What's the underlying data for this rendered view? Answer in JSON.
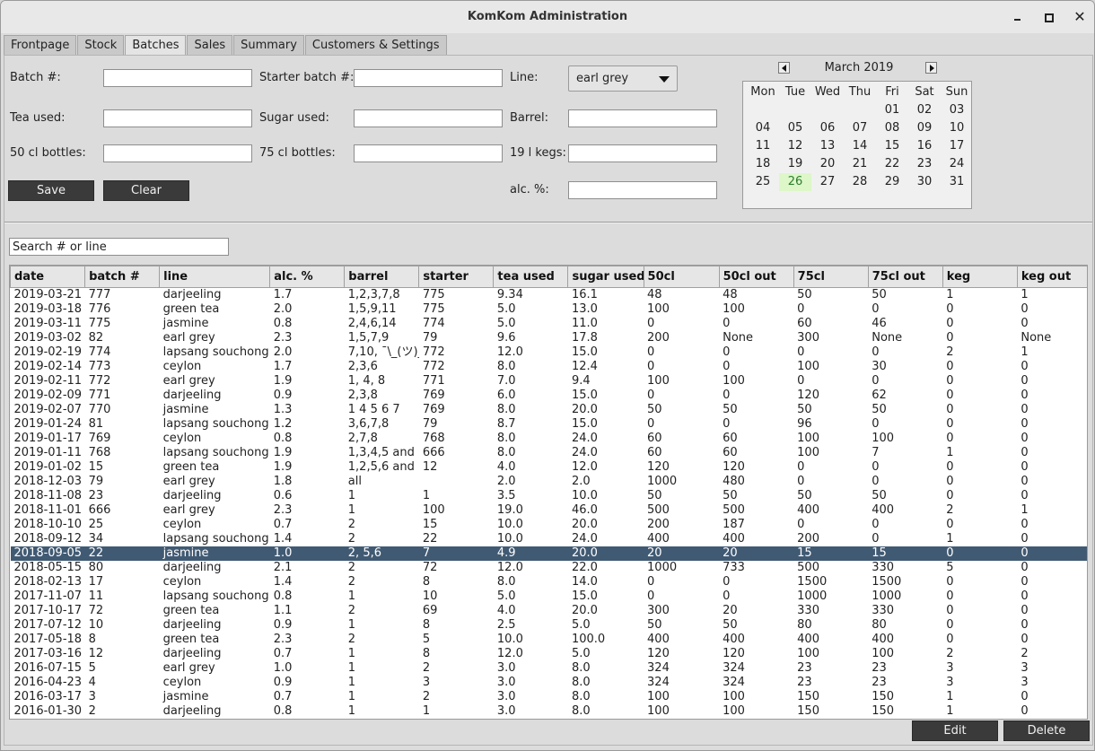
{
  "window": {
    "title": "KomKom Administration"
  },
  "tabs": [
    "Frontpage",
    "Stock",
    "Batches",
    "Sales",
    "Summary",
    "Customers & Settings"
  ],
  "active_tab": "Batches",
  "form": {
    "batch_label": "Batch #:",
    "tea_label": "Tea used:",
    "bottles50_label": "50 cl bottles:",
    "starter_label": "Starter batch #:",
    "sugar_label": "Sugar used:",
    "bottles75_label": "75 cl bottles:",
    "line_label": "Line:",
    "barrel_label": "Barrel:",
    "kegs_label": "19 l kegs:",
    "alc_label": "alc. %:",
    "line_value": "earl grey",
    "save": "Save",
    "clear": "Clear"
  },
  "calendar": {
    "title": "March 2019",
    "weekdays": [
      "Mon",
      "Tue",
      "Wed",
      "Thu",
      "Fri",
      "Sat",
      "Sun"
    ],
    "weeks": [
      [
        "",
        "",
        "",
        "",
        "01",
        "02",
        "03"
      ],
      [
        "04",
        "05",
        "06",
        "07",
        "08",
        "09",
        "10"
      ],
      [
        "11",
        "12",
        "13",
        "14",
        "15",
        "16",
        "17"
      ],
      [
        "18",
        "19",
        "20",
        "21",
        "22",
        "23",
        "24"
      ],
      [
        "25",
        "26",
        "27",
        "28",
        "29",
        "30",
        "31"
      ]
    ],
    "today": "26",
    "today_color": "#ddf7c9"
  },
  "search": {
    "value": "Search # or line"
  },
  "table": {
    "columns": [
      "date",
      "batch #",
      "line",
      "alc. %",
      "barrel",
      "starter",
      "tea used",
      "sugar used",
      "50cl",
      "50cl out",
      "75cl",
      "75cl out",
      "keg",
      "keg out"
    ],
    "selected_index": 18,
    "selected_color": "#415a73",
    "rows": [
      [
        "2019-03-21",
        "777",
        "darjeeling",
        "1.7",
        "1,2,3,7,8",
        "775",
        "9.34",
        "16.1",
        "48",
        "48",
        "50",
        "50",
        "1",
        "1"
      ],
      [
        "2019-03-18",
        "776",
        "green tea",
        "2.0",
        "1,5,9,11",
        "775",
        "5.0",
        "13.0",
        "100",
        "100",
        "0",
        "0",
        "0",
        "0"
      ],
      [
        "2019-03-11",
        "775",
        "jasmine",
        "0.8",
        "2,4,6,14",
        "774",
        "5.0",
        "11.0",
        "0",
        "0",
        "60",
        "46",
        "0",
        "0"
      ],
      [
        "2019-03-02",
        "82",
        "earl grey",
        "2.3",
        "1,5,7,9",
        "79",
        "9.6",
        "17.8",
        "200",
        "None",
        "300",
        "None",
        "0",
        "None"
      ],
      [
        "2019-02-19",
        "774",
        "lapsang souchong",
        "2.0",
        "7,10, ¯\\_(ツ)_/¯",
        "772",
        "12.0",
        "15.0",
        "0",
        "0",
        "0",
        "0",
        "2",
        "1"
      ],
      [
        "2019-02-14",
        "773",
        "ceylon",
        "1.7",
        "2,3,6",
        "772",
        "8.0",
        "12.4",
        "0",
        "0",
        "100",
        "30",
        "0",
        "0"
      ],
      [
        "2019-02-11",
        "772",
        "earl grey",
        "1.9",
        "1, 4, 8",
        "771",
        "7.0",
        "9.4",
        "100",
        "100",
        "0",
        "0",
        "0",
        "0"
      ],
      [
        "2019-02-09",
        "771",
        "darjeeling",
        "0.9",
        "2,3,8",
        "769",
        "6.0",
        "15.0",
        "0",
        "0",
        "120",
        "62",
        "0",
        "0"
      ],
      [
        "2019-02-07",
        "770",
        "jasmine",
        "1.3",
        "1 4 5 6 7",
        "769",
        "8.0",
        "20.0",
        "50",
        "50",
        "50",
        "50",
        "0",
        "0"
      ],
      [
        "2019-01-24",
        "81",
        "lapsang souchong",
        "1.2",
        "3,6,7,8",
        "79",
        "8.7",
        "15.0",
        "0",
        "0",
        "96",
        "0",
        "0",
        "0"
      ],
      [
        "2019-01-17",
        "769",
        "ceylon",
        "0.8",
        "2,7,8",
        "768",
        "8.0",
        "24.0",
        "60",
        "60",
        "100",
        "100",
        "0",
        "0"
      ],
      [
        "2019-01-11",
        "768",
        "lapsang souchong",
        "1.9",
        "1,3,4,5 and",
        "666",
        "8.0",
        "24.0",
        "60",
        "60",
        "100",
        "7",
        "1",
        "0"
      ],
      [
        "2019-01-02",
        "15",
        "green tea",
        "1.9",
        "1,2,5,6 and",
        "12",
        "4.0",
        "12.0",
        "120",
        "120",
        "0",
        "0",
        "0",
        "0"
      ],
      [
        "2018-12-03",
        "79",
        "earl grey",
        "1.8",
        "all",
        "",
        "2.0",
        "2.0",
        "1000",
        "480",
        "0",
        "0",
        "0",
        "0"
      ],
      [
        "2018-11-08",
        "23",
        "darjeeling",
        "0.6",
        "1",
        "1",
        "3.5",
        "10.0",
        "50",
        "50",
        "50",
        "50",
        "0",
        "0"
      ],
      [
        "2018-11-01",
        "666",
        "earl grey",
        "2.3",
        "1",
        "100",
        "19.0",
        "46.0",
        "500",
        "500",
        "400",
        "400",
        "2",
        "1"
      ],
      [
        "2018-10-10",
        "25",
        "ceylon",
        "0.7",
        "2",
        "15",
        "10.0",
        "20.0",
        "200",
        "187",
        "0",
        "0",
        "0",
        "0"
      ],
      [
        "2018-09-12",
        "34",
        "lapsang souchong",
        "1.4",
        "2",
        "22",
        "10.0",
        "24.0",
        "400",
        "400",
        "200",
        "0",
        "1",
        "0"
      ],
      [
        "2018-09-05",
        "22",
        "jasmine",
        "1.0",
        "2, 5,6",
        "7",
        "4.9",
        "20.0",
        "20",
        "20",
        "15",
        "15",
        "0",
        "0"
      ],
      [
        "2018-05-15",
        "80",
        "darjeeling",
        "2.1",
        "2",
        "72",
        "12.0",
        "22.0",
        "1000",
        "733",
        "500",
        "330",
        "5",
        "0"
      ],
      [
        "2018-02-13",
        "17",
        "ceylon",
        "1.4",
        "2",
        "8",
        "8.0",
        "14.0",
        "0",
        "0",
        "1500",
        "1500",
        "0",
        "0"
      ],
      [
        "2017-11-07",
        "11",
        "lapsang souchong",
        "0.8",
        "1",
        "10",
        "5.0",
        "15.0",
        "0",
        "0",
        "1000",
        "1000",
        "0",
        "0"
      ],
      [
        "2017-10-17",
        "72",
        "green tea",
        "1.1",
        "2",
        "69",
        "4.0",
        "20.0",
        "300",
        "20",
        "330",
        "330",
        "0",
        "0"
      ],
      [
        "2017-07-12",
        "10",
        "darjeeling",
        "0.9",
        "1",
        "8",
        "2.5",
        "5.0",
        "50",
        "50",
        "80",
        "80",
        "0",
        "0"
      ],
      [
        "2017-05-18",
        "8",
        "green tea",
        "2.3",
        "2",
        "5",
        "10.0",
        "100.0",
        "400",
        "400",
        "400",
        "400",
        "0",
        "0"
      ],
      [
        "2017-03-16",
        "12",
        "darjeeling",
        "0.7",
        "1",
        "8",
        "12.0",
        "5.0",
        "120",
        "120",
        "100",
        "100",
        "2",
        "2"
      ],
      [
        "2016-07-15",
        "5",
        "earl grey",
        "1.0",
        "1",
        "2",
        "3.0",
        "8.0",
        "324",
        "324",
        "23",
        "23",
        "3",
        "3"
      ],
      [
        "2016-04-23",
        "4",
        "ceylon",
        "0.9",
        "1",
        "3",
        "3.0",
        "8.0",
        "324",
        "324",
        "23",
        "23",
        "3",
        "3"
      ],
      [
        "2016-03-17",
        "3",
        "jasmine",
        "0.7",
        "1",
        "2",
        "3.0",
        "8.0",
        "100",
        "100",
        "150",
        "150",
        "1",
        "0"
      ],
      [
        "2016-01-30",
        "2",
        "darjeeling",
        "0.8",
        "1",
        "1",
        "3.0",
        "8.0",
        "100",
        "100",
        "150",
        "150",
        "1",
        "0"
      ]
    ]
  },
  "actions": {
    "edit": "Edit",
    "delete": "Delete"
  }
}
